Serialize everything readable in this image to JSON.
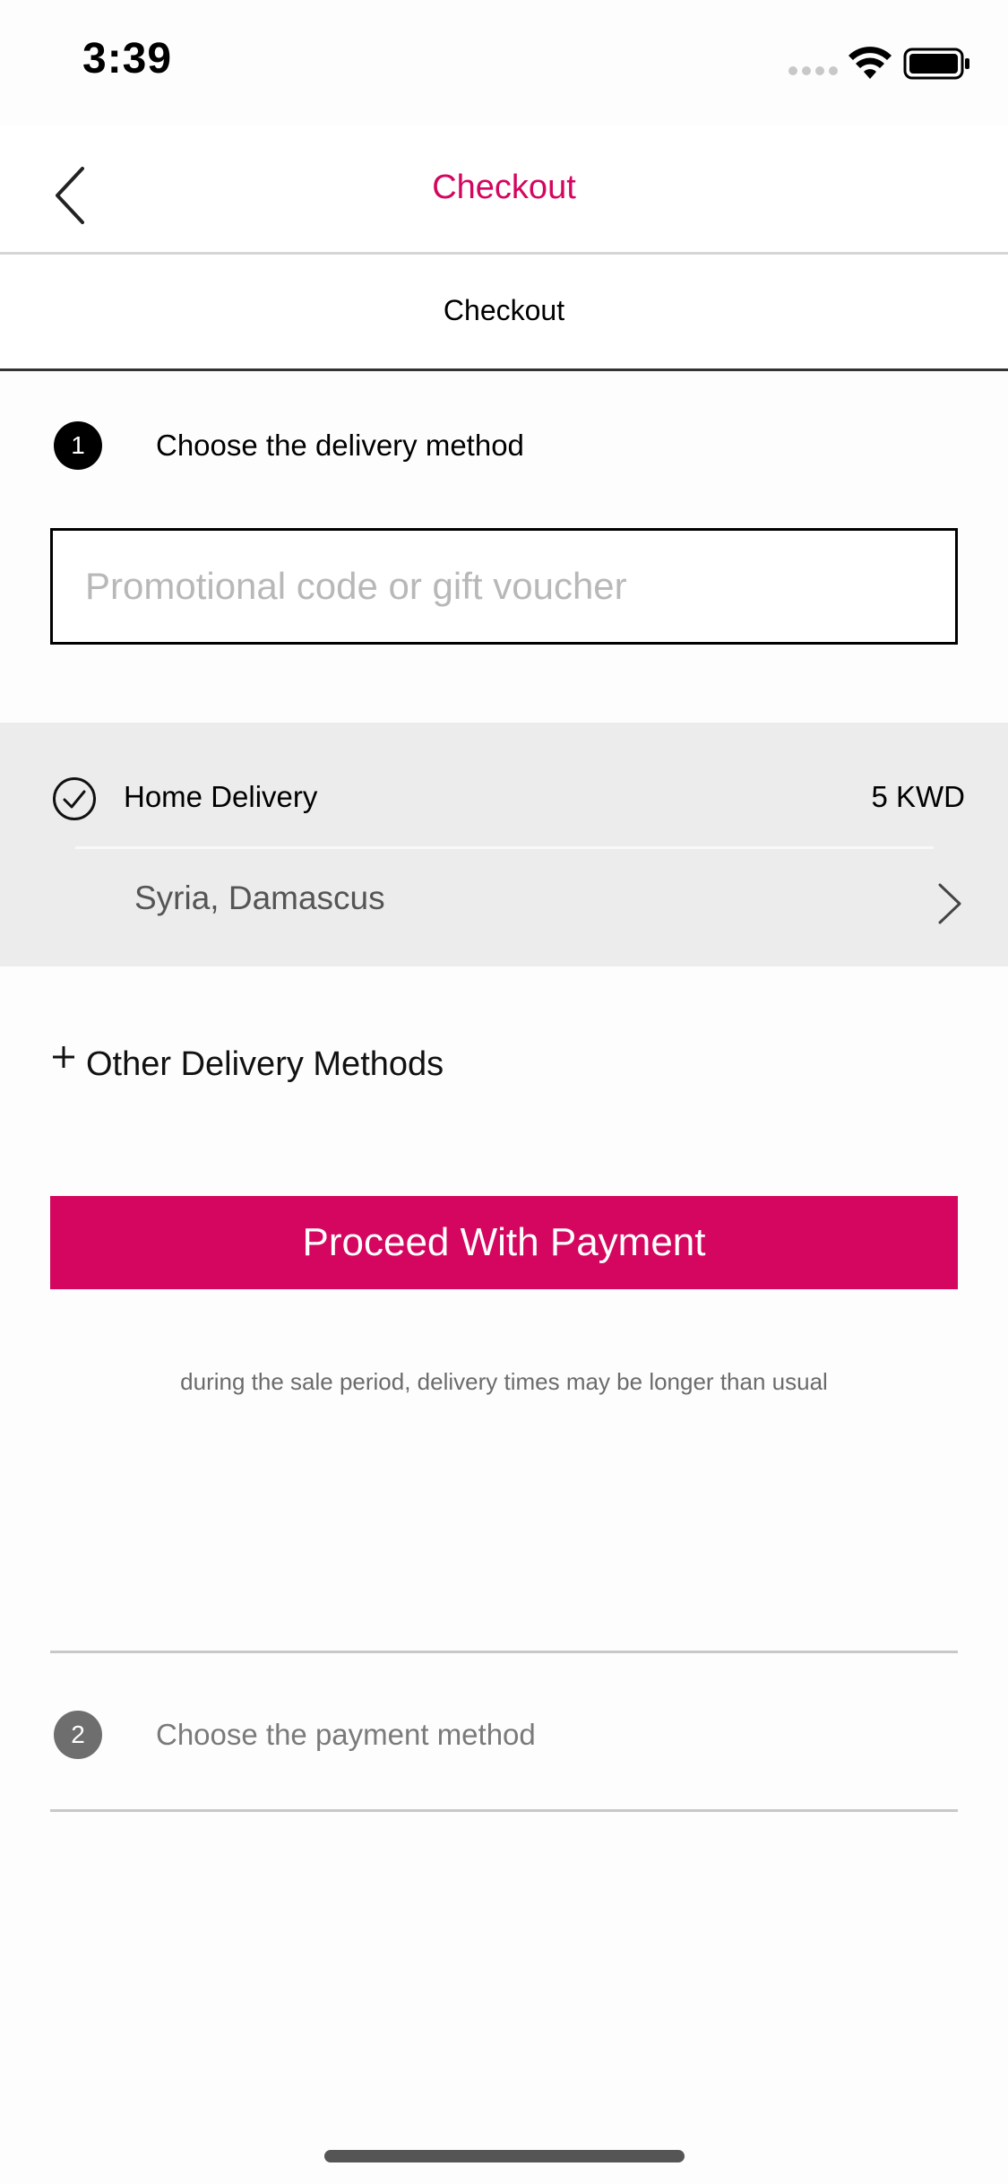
{
  "status_bar": {
    "time": "3:39"
  },
  "nav": {
    "title": "Checkout"
  },
  "tab": {
    "label": "Checkout"
  },
  "step1": {
    "number": "1",
    "label": "Choose the delivery method"
  },
  "promo": {
    "placeholder": "Promotional code or gift voucher",
    "value": ""
  },
  "delivery": {
    "method": "Home Delivery",
    "price": "5 KWD",
    "address": "Syria, Damascus",
    "selected": true
  },
  "other_methods": {
    "symbol": "+",
    "label": "Other Delivery Methods"
  },
  "proceed_button": {
    "label": "Proceed With Payment"
  },
  "sale_note": "during the sale period, delivery times may be longer than usual",
  "step2": {
    "number": "2",
    "label": "Choose the payment method"
  },
  "colors": {
    "accent": "#d4065f",
    "selected_bg": "#ececec"
  },
  "icons": {
    "back": "chevron-left-icon",
    "selected": "check-circle-icon",
    "address": "chevron-right-icon",
    "expand": "plus-icon"
  }
}
